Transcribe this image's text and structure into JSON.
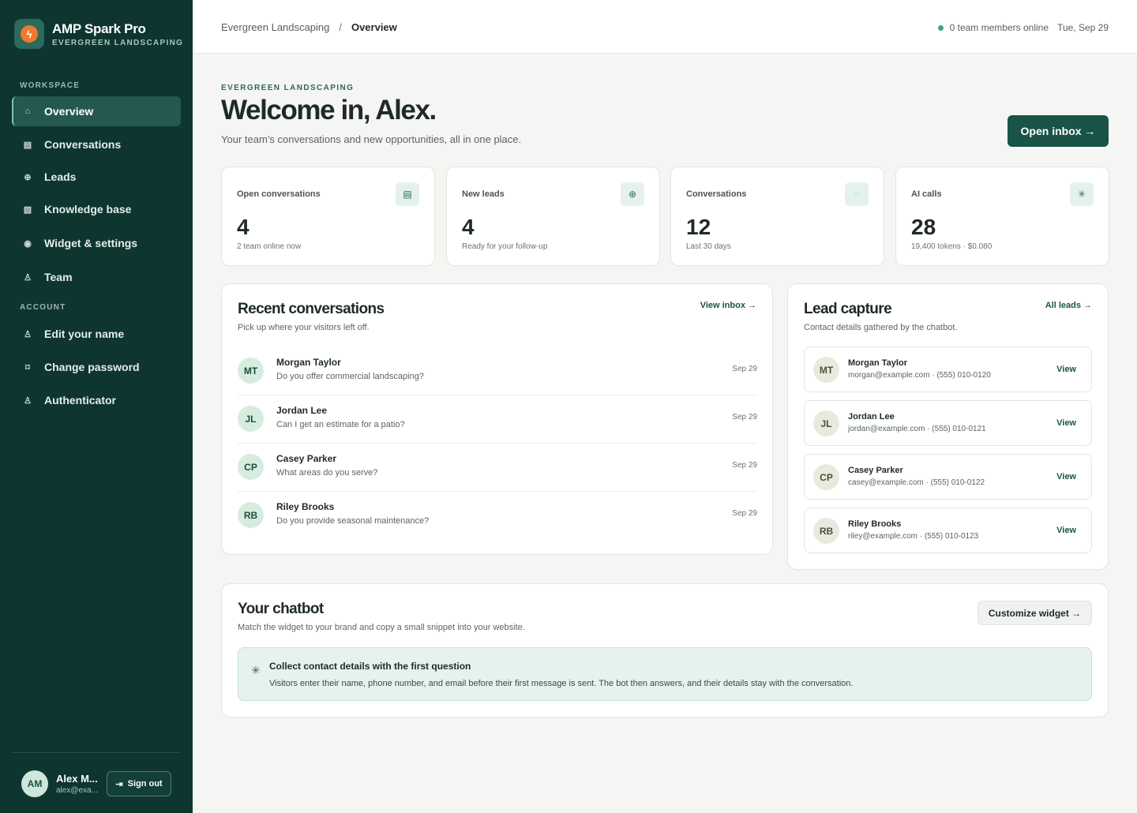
{
  "brand": {
    "name": "AMP Spark Pro",
    "subtitle": "EVERGREEN LANDSCAPING",
    "logo_icon": "flame-icon"
  },
  "sidebar": {
    "workspace_label": "WORKSPACE",
    "account_label": "ACCOUNT",
    "workspace_items": [
      {
        "label": "Overview",
        "icon": "⌂",
        "active": true
      },
      {
        "label": "Conversations",
        "icon": "▤"
      },
      {
        "label": "Leads",
        "icon": "⊕"
      },
      {
        "label": "Knowledge base",
        "icon": "▧"
      },
      {
        "label": "Widget & settings",
        "icon": "◉"
      },
      {
        "label": "Team",
        "icon": "♙"
      }
    ],
    "account_items": [
      {
        "label": "Edit your name",
        "icon": "♙"
      },
      {
        "label": "Change password",
        "icon": "⌑"
      },
      {
        "label": "Authenticator",
        "icon": "♙"
      }
    ],
    "user": {
      "initials": "AM",
      "name": "Alex M...",
      "email": "alex@exa..."
    },
    "signout_label": "Sign out"
  },
  "topbar": {
    "breadcrumb_root": "Evergreen Landscaping",
    "breadcrumb_sep": "/",
    "breadcrumb_current": "Overview",
    "online_text": "0 team members online",
    "date": "Tue, Sep 29"
  },
  "hero": {
    "eyebrow": "EVERGREEN LANDSCAPING",
    "title": "Welcome in, Alex.",
    "subtitle": "Your team’s conversations and new opportunities, all in one place.",
    "cta": "Open inbox →"
  },
  "stats": [
    {
      "label": "Open conversations",
      "value": "4",
      "note": "2 team online now",
      "icon": "▤"
    },
    {
      "label": "New leads",
      "value": "4",
      "note": "Ready for your follow-up",
      "icon": "⊕"
    },
    {
      "label": "Conversations",
      "value": "12",
      "note": "Last 30 days",
      "icon": "○"
    },
    {
      "label": "AI calls",
      "value": "28",
      "note": "19,400 tokens · $0.080",
      "icon": "✳"
    }
  ],
  "recent": {
    "title": "Recent conversations",
    "subtitle": "Pick up where your visitors left off.",
    "link": "View inbox →",
    "rows": [
      {
        "initials": "MT",
        "name": "Morgan Taylor",
        "message": "Do you offer commercial landscaping?",
        "date": "Sep 29"
      },
      {
        "initials": "JL",
        "name": "Jordan Lee",
        "message": "Can I get an estimate for a patio?",
        "date": "Sep 29"
      },
      {
        "initials": "CP",
        "name": "Casey Parker",
        "message": "What areas do you serve?",
        "date": "Sep 29"
      },
      {
        "initials": "RB",
        "name": "Riley Brooks",
        "message": "Do you provide seasonal maintenance?",
        "date": "Sep 29"
      }
    ]
  },
  "leads": {
    "title": "Lead capture",
    "subtitle": "Contact details gathered by the chatbot.",
    "link": "All leads →",
    "view_label": "View",
    "rows": [
      {
        "initials": "MT",
        "name": "Morgan Taylor",
        "contact": "morgan@example.com · (555) 010-0120"
      },
      {
        "initials": "JL",
        "name": "Jordan Lee",
        "contact": "jordan@example.com · (555) 010-0121"
      },
      {
        "initials": "CP",
        "name": "Casey Parker",
        "contact": "casey@example.com · (555) 010-0122"
      },
      {
        "initials": "RB",
        "name": "Riley Brooks",
        "contact": "riley@example.com · (555) 010-0123"
      }
    ]
  },
  "chatbot": {
    "title": "Your chatbot",
    "subtitle": "Match the widget to your brand and copy a small snippet into your website.",
    "button": "Customize widget →",
    "tip_icon": "✳",
    "tip_title": "Collect contact details with the first question",
    "tip_text": "Visitors enter their name, phone number, and email before their first message is sent. The bot then answers, and their details stay with the conversation."
  }
}
